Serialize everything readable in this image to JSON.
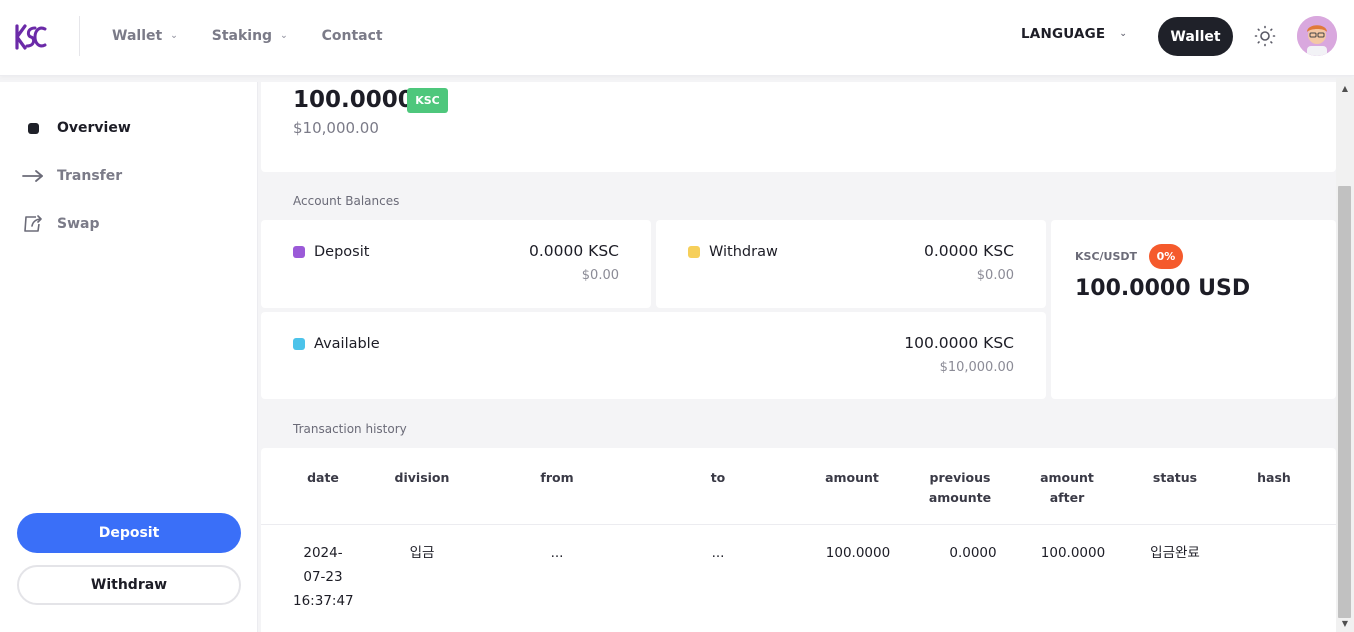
{
  "header": {
    "logo_text": "KSC",
    "nav": [
      {
        "label": "Wallet",
        "has_dropdown": true,
        "icon": "chevron-down-icon"
      },
      {
        "label": "Staking",
        "has_dropdown": true,
        "icon": "chevron-down-icon"
      },
      {
        "label": "Contact",
        "has_dropdown": false
      }
    ],
    "language_label": "LANGUAGE",
    "wallet_button": "Wallet",
    "theme_icon": "sun-icon",
    "avatar_icon": "user-avatar"
  },
  "sidebar": {
    "items": [
      {
        "label": "Overview",
        "icon": "square-dot-icon",
        "active": true
      },
      {
        "label": "Transfer",
        "icon": "arrow-right-icon",
        "active": false
      },
      {
        "label": "Swap",
        "icon": "swap-icon",
        "active": false
      }
    ],
    "deposit_button": "Deposit",
    "withdraw_button": "Withdraw"
  },
  "summary": {
    "amount": "100.0000",
    "currency_badge": "KSC",
    "usd_value": "$10,000.00"
  },
  "balances": {
    "section_title": "Account Balances",
    "deposit": {
      "label": "Deposit",
      "value": "0.0000 KSC",
      "usd": "$0.00",
      "color": "#9b5ad8"
    },
    "withdraw": {
      "label": "Withdraw",
      "value": "0.0000 KSC",
      "usd": "$0.00",
      "color": "#f6cf5a"
    },
    "available": {
      "label": "Available",
      "value": "100.0000 KSC",
      "usd": "$10,000.00",
      "color": "#4cc3ea"
    }
  },
  "rate": {
    "pair": "KSC/USDT",
    "change_badge": "0%",
    "value": "100.0000 USD",
    "badge_color": "#f55a2c"
  },
  "transactions": {
    "section_title": "Transaction history",
    "columns": [
      "date",
      "division",
      "from",
      "to",
      "amount",
      "previous\namounte",
      "amount\nafter",
      "status",
      "hash"
    ],
    "rows": [
      {
        "date": "2024-\n07-23\n16:37:47",
        "division": "입금",
        "from": "...",
        "to": "...",
        "amount": "100.0000",
        "previous_amount": "0.0000",
        "amount_after": "100.0000",
        "status": "입금완료",
        "hash": ""
      }
    ]
  },
  "colors": {
    "primary": "#3a6ff8",
    "dark": "#1f2129",
    "success": "#4ec77c",
    "brand_purple": "#6b2aa8"
  }
}
